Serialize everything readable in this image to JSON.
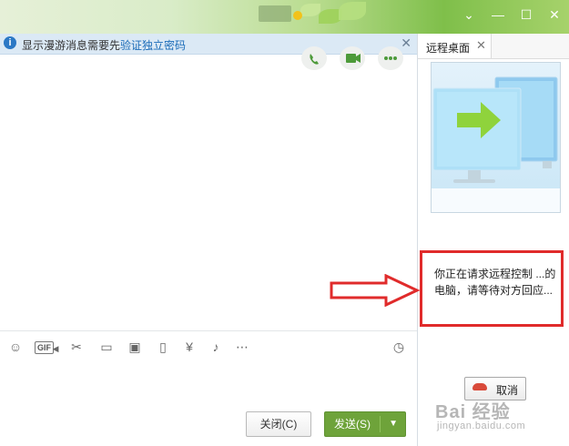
{
  "titlebar": {
    "controls": [
      "chevron-down-icon",
      "minimize-icon",
      "maximize-icon",
      "close-icon"
    ],
    "accent_color": "#7fbf4a"
  },
  "notice": {
    "text": "显示漫游消息需要先",
    "link": "验证独立密码"
  },
  "chat_actions": [
    "phone-icon",
    "video-icon",
    "more-icon"
  ],
  "toolbar": {
    "gif_label": "GIF",
    "icons": [
      "emoji-icon",
      "gif-icon",
      "scissors-icon",
      "folder-icon",
      "image-icon",
      "shake-icon",
      "red-packet-icon",
      "music-icon",
      "more-icon",
      "history-clock-icon"
    ]
  },
  "buttons": {
    "close_label": "关闭(C)",
    "send_label": "发送(S)"
  },
  "side_panel": {
    "tab_label": "远程桌面",
    "message": "你正在请求远程控制 ...的电脑，请等待对方回应...",
    "cancel_label": "取消"
  },
  "watermark": {
    "line1": "Bai 经验",
    "line2": "jingyan.baidu.com"
  },
  "colors": {
    "highlight_red": "#e02b2b",
    "send_green": "#6ea33a",
    "notice_bg": "#dbe9f5"
  }
}
